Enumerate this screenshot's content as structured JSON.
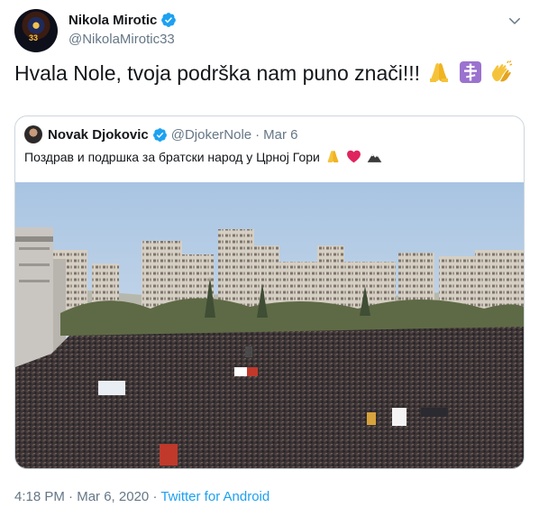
{
  "author": {
    "display_name": "Nikola Mirotic",
    "handle": "@NikolaMirotic33",
    "avatar_jersey_number": "33"
  },
  "tweet": {
    "text": "Hvala Nole, tvoja podrška nam puno znači!!!",
    "emojis": [
      "folded-hands-icon",
      "orthodox-cross-icon",
      "clapping-hands-icon"
    ]
  },
  "quoted": {
    "display_name": "Novak Djokovic",
    "handle": "@DjokerNole",
    "separator": "·",
    "date": "Mar 6",
    "text": "Поздрав и подршка за братски народ у Црној Гори",
    "emojis": [
      "folded-hands-icon",
      "red-heart-icon",
      "mountain-icon"
    ]
  },
  "meta": {
    "time": "4:18 PM",
    "separator": "·",
    "date": "Mar 6, 2020",
    "source": "Twitter for Android"
  },
  "colors": {
    "verified_blue": "#1da1f2",
    "link_blue": "#1da1f2",
    "secondary_text": "#657786",
    "border": "#ccd6dd"
  }
}
